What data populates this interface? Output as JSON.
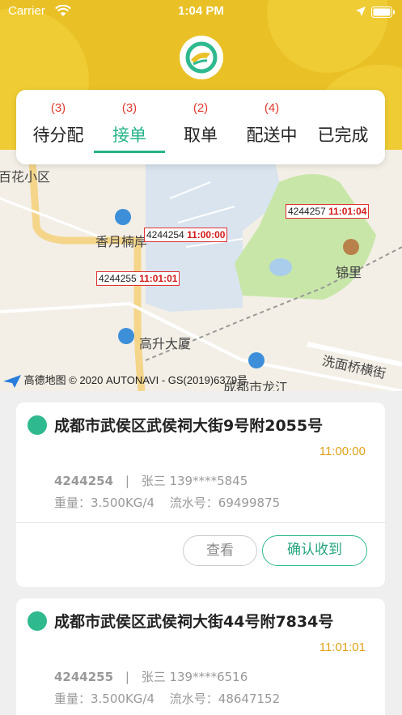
{
  "status_bar": {
    "carrier": "Carrier",
    "time": "1:04 PM"
  },
  "tabs": [
    {
      "count": "(3)",
      "label": "待分配",
      "active": false
    },
    {
      "count": "(3)",
      "label": "接单",
      "active": true
    },
    {
      "count": "(2)",
      "label": "取单",
      "active": false
    },
    {
      "count": "(4)",
      "label": "配送中",
      "active": false
    },
    {
      "count": "",
      "label": "已完成",
      "active": false
    }
  ],
  "map": {
    "places": [
      "百花小区",
      "香月楠岸",
      "高升大厦",
      "锦里",
      "洗面桥横街",
      "成都市龙江"
    ],
    "markers": [
      {
        "order_id": "4244254",
        "time": "11:00:00"
      },
      {
        "order_id": "4244257",
        "time": "11:01:04"
      },
      {
        "order_id": "4244255",
        "time": "11:01:01"
      }
    ],
    "copyright": "高德地图 © 2020 AUTONAVI - GS(2019)6379号"
  },
  "orders": [
    {
      "address": "成都市武侯区武侯祠大街9号附2055号",
      "time": "11:00:00",
      "order_id": "4244254",
      "separator": "|",
      "contact": "张三 139****5845",
      "weight": "重量：3.500KG/4",
      "serial": "流水号：69499875",
      "view_label": "查看",
      "confirm_label": "确认收到"
    },
    {
      "address": "成都市武侯区武侯祠大街44号附7834号",
      "time": "11:01:01",
      "order_id": "4244255",
      "separator": "|",
      "contact": "张三 139****6516",
      "weight": "重量：3.500KG/4",
      "serial": "流水号：48647152"
    }
  ],
  "colors": {
    "header": "#e9c127",
    "accent": "#26b38a",
    "count": "#e23a2f",
    "time": "#e0a21a"
  }
}
